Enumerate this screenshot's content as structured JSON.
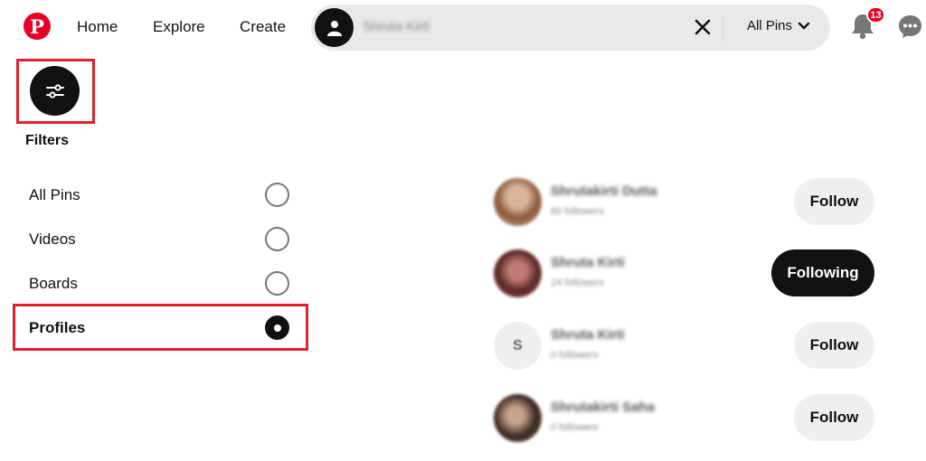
{
  "header": {
    "nav": [
      "Home",
      "Explore",
      "Create"
    ],
    "search_value": "Shruta Kirti",
    "scope_label": "All Pins",
    "notification_count": "13"
  },
  "filters": {
    "title": "Filters",
    "options": [
      {
        "label": "All Pins",
        "selected": false
      },
      {
        "label": "Videos",
        "selected": false
      },
      {
        "label": "Boards",
        "selected": false
      },
      {
        "label": "Profiles",
        "selected": true
      }
    ]
  },
  "profiles": [
    {
      "name": "Shrutakirti Dutta",
      "followers": "60 followers",
      "button": "Follow"
    },
    {
      "name": "Shruta Kirti",
      "followers": "24 followers",
      "button": "Following"
    },
    {
      "name": "Shruta Kirti",
      "followers": "0 followers",
      "button": "Follow",
      "initial": "S"
    },
    {
      "name": "Shrutakirti Saha",
      "followers": "0 followers",
      "button": "Follow"
    }
  ],
  "colors": {
    "brand": "#e60023",
    "highlight": "#e0202c",
    "dark": "#111111",
    "light_button": "#efefef"
  }
}
